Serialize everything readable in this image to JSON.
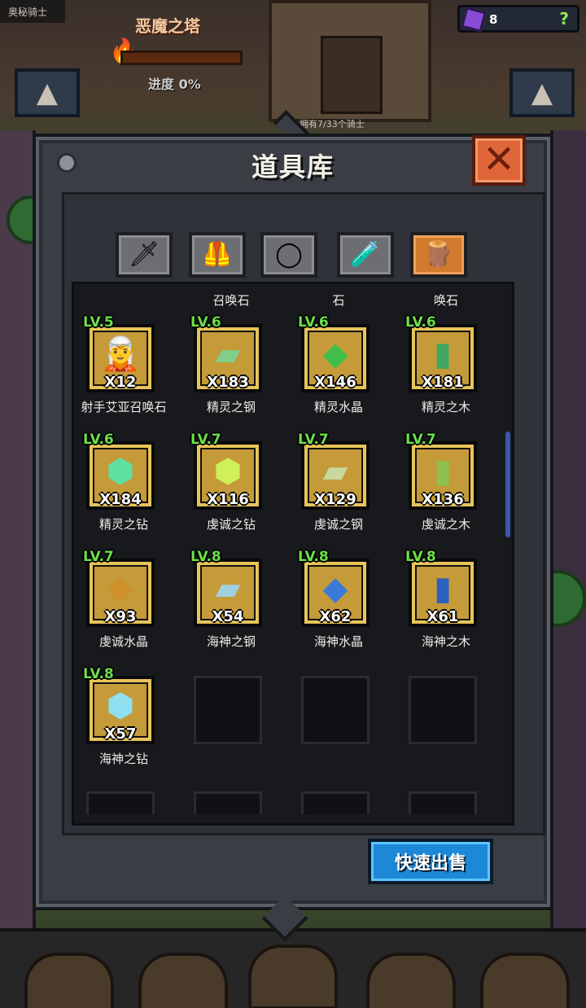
{
  "hud": {
    "left_label": "奥秘骑士",
    "knight_count": "拥有7/33个骑士"
  },
  "tower": {
    "title": "恶魔之塔",
    "progress_label": "进度 0%",
    "progress": 0
  },
  "gems": {
    "count": "8",
    "help": "?"
  },
  "modal": {
    "title": "道具库",
    "close": "✕"
  },
  "tabs": [
    {
      "name": "weapon",
      "icon": "🗡"
    },
    {
      "name": "armor",
      "icon": "🦺"
    },
    {
      "name": "ring",
      "icon": "◯"
    },
    {
      "name": "potion",
      "icon": "🧪"
    },
    {
      "name": "material",
      "icon": "🪵",
      "active": true
    }
  ],
  "partial_row": [
    "",
    "召唤石",
    "石",
    "唤石"
  ],
  "items": [
    {
      "lvl": "LV.5",
      "qty": "X12",
      "name": "射手艾亚召唤石",
      "art": "🧝",
      "color": "#7fd06a"
    },
    {
      "lvl": "LV.6",
      "qty": "X183",
      "name": "精灵之钢",
      "art": "▰",
      "color": "#7fcf8a"
    },
    {
      "lvl": "LV.6",
      "qty": "X146",
      "name": "精灵水晶",
      "art": "◆",
      "color": "#3fbf4a"
    },
    {
      "lvl": "LV.6",
      "qty": "X181",
      "name": "精灵之木",
      "art": "▮",
      "color": "#3fa860"
    },
    {
      "lvl": "LV.6",
      "qty": "X184",
      "name": "精灵之钻",
      "art": "⬢",
      "color": "#5ee0a0"
    },
    {
      "lvl": "LV.7",
      "qty": "X116",
      "name": "虔诚之钻",
      "art": "⬢",
      "color": "#d0f05a"
    },
    {
      "lvl": "LV.7",
      "qty": "X129",
      "name": "虔诚之钢",
      "art": "▰",
      "color": "#c8d8a0"
    },
    {
      "lvl": "LV.7",
      "qty": "X136",
      "name": "虔诚之木",
      "art": "▮",
      "color": "#8cc050"
    },
    {
      "lvl": "LV.7",
      "qty": "X93",
      "name": "虔诚水晶",
      "art": "◆",
      "color": "#d0902a"
    },
    {
      "lvl": "LV.8",
      "qty": "X54",
      "name": "海神之钢",
      "art": "▰",
      "color": "#a0d0e0"
    },
    {
      "lvl": "LV.8",
      "qty": "X62",
      "name": "海神水晶",
      "art": "◆",
      "color": "#3a7ad8"
    },
    {
      "lvl": "LV.8",
      "qty": "X61",
      "name": "海神之木",
      "art": "▮",
      "color": "#2a62c0"
    },
    {
      "lvl": "LV.8",
      "qty": "X57",
      "name": "海神之钻",
      "art": "⬢",
      "color": "#8ee0f0"
    }
  ],
  "sell_button": "快速出售"
}
